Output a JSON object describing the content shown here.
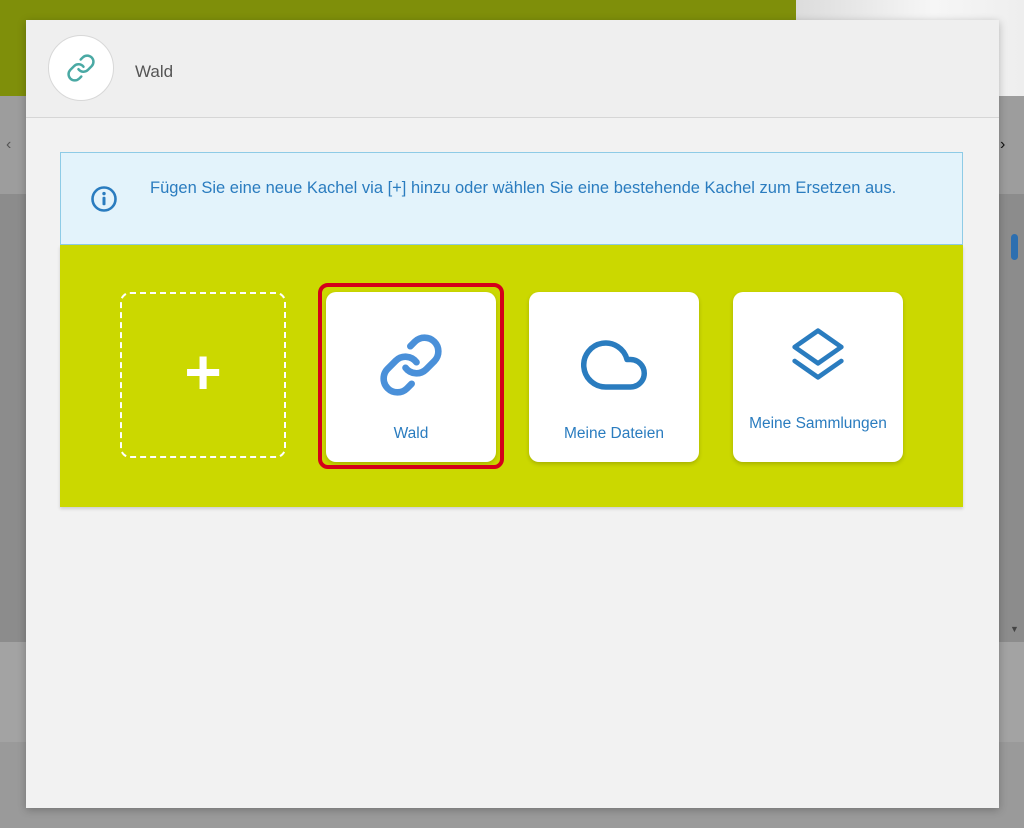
{
  "colors": {
    "accent_blue": "#2a7cbf",
    "tile_area_green": "#cbd800",
    "selection_red": "#d4001a",
    "info_bg": "#e3f3fb",
    "header_icon_teal": "#4aa9a4"
  },
  "modal": {
    "title": "Wald",
    "header_icon": "link-icon",
    "info": {
      "icon": "info-icon",
      "text": "Fügen Sie eine neue Kachel via [+] hinzu oder wählen Sie eine bestehende Kachel zum Ersetzen aus."
    },
    "add_tile": {
      "label": "+",
      "icon": "plus-icon"
    },
    "tiles": [
      {
        "label": "Wald",
        "icon": "link-icon",
        "selected": true
      },
      {
        "label": "Meine Dateien",
        "icon": "cloud-icon",
        "selected": false
      },
      {
        "label": "Meine Sammlungen",
        "icon": "layers-icon",
        "selected": false
      }
    ]
  }
}
